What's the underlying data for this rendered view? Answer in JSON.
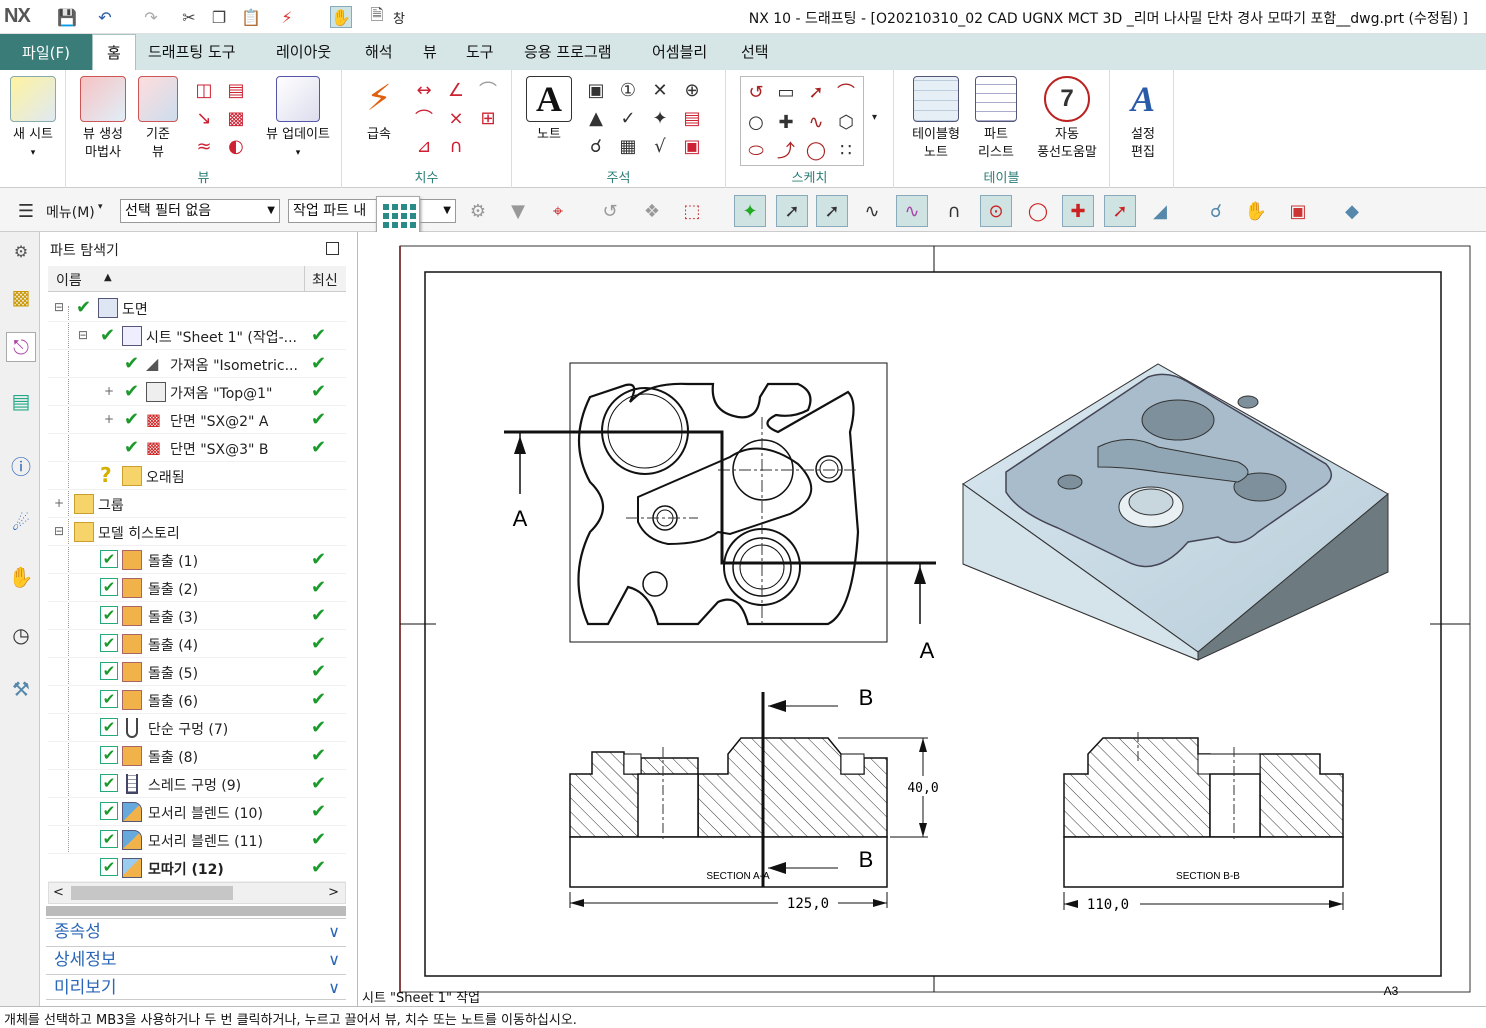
{
  "window": {
    "logo": "NX",
    "title": "NX 10 - 드래프팅 - [O20210310_02 CAD UGNX MCT 3D _리머 나사밀 단차 경사 모따기 포함__dwg.prt (수정됨) ]",
    "window_menu": "창"
  },
  "menu": {
    "file": "파일(F)",
    "tabs": [
      "홈",
      "드래프팅 도구",
      "레이아웃",
      "해석",
      "뷰",
      "도구",
      "응용 프로그램",
      "어셈블리",
      "선택"
    ]
  },
  "ribbon": {
    "new_sheet": "새 시트",
    "view_wizard": [
      "뷰 생성",
      "마법사"
    ],
    "base_view": [
      "기준",
      "뷰"
    ],
    "view_update": "뷰 업데이트",
    "group_view": "뷰",
    "rapid": "급속",
    "group_dimension": "치수",
    "note": "노트",
    "group_annotation": "주석",
    "group_sketch": "스케치",
    "tabular_note": [
      "테이블형",
      "노트"
    ],
    "parts_list": [
      "파트",
      "리스트"
    ],
    "auto_balloon": [
      "자동",
      "풍선도움말"
    ],
    "group_table": "테이블",
    "edit_settings": [
      "설정",
      "편집"
    ]
  },
  "toolbar": {
    "menu": "메뉴(M)",
    "selection_filter": "선택 필터 없음",
    "work_part": "작업 파트 내"
  },
  "navigator": {
    "title": "파트 탐색기",
    "col_name": "이름",
    "col_latest": "최신",
    "nodes": [
      {
        "label": "도면",
        "level": 0
      },
      {
        "label": "시트 \"Sheet 1\" (작업-...",
        "level": 1
      },
      {
        "label": "가져옴 \"Isometric...",
        "level": 2
      },
      {
        "label": "가져옴 \"Top@1\"",
        "level": 2
      },
      {
        "label": "단면 \"SX@2\" A",
        "level": 2
      },
      {
        "label": "단면 \"SX@3\" B",
        "level": 2
      },
      {
        "label": "오래됨",
        "level": 1
      },
      {
        "label": "그룹",
        "level": 0
      },
      {
        "label": "모델 히스토리",
        "level": 0
      },
      {
        "label": "돌출 (1)",
        "level": 1
      },
      {
        "label": "돌출 (2)",
        "level": 1
      },
      {
        "label": "돌출 (3)",
        "level": 1
      },
      {
        "label": "돌출 (4)",
        "level": 1
      },
      {
        "label": "돌출 (5)",
        "level": 1
      },
      {
        "label": "돌출 (6)",
        "level": 1
      },
      {
        "label": "단순 구멍 (7)",
        "level": 1
      },
      {
        "label": "돌출 (8)",
        "level": 1
      },
      {
        "label": "스레드 구멍 (9)",
        "level": 1
      },
      {
        "label": "모서리 블렌드 (10)",
        "level": 1
      },
      {
        "label": "모서리 블렌드 (11)",
        "level": 1
      },
      {
        "label": "모따기 (12)",
        "level": 1
      }
    ],
    "panels": [
      "종속성",
      "상세정보",
      "미리보기"
    ]
  },
  "drawing": {
    "section_a_label": "A",
    "section_b_label": "B",
    "section_aa": "SECTION A-A",
    "section_bb": "SECTION B-B",
    "dim_height": "40,0",
    "dim_width_a": "125,0",
    "dim_width_b": "110,0",
    "sheet_size": "A3"
  },
  "status": {
    "sheet": "시트 \"Sheet 1\" 작업",
    "hint": "개체를 선택하고 MB3을 사용하거나 두 번 클릭하거나, 누르고 끌어서 뷰, 치수 또는 노트를 이동하십시오."
  },
  "colors": {
    "accent": "#3a7c78",
    "menubar": "#d6e6e6",
    "check_green": "#1a9a2a",
    "panel_blue": "#2a66b8"
  }
}
